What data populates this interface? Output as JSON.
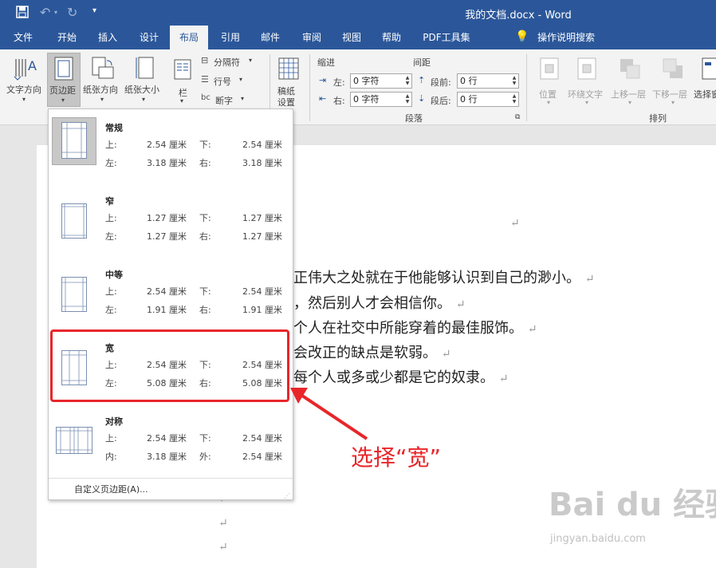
{
  "window": {
    "title": "我的文档.docx  -  Word"
  },
  "tabs": [
    {
      "label": "文件"
    },
    {
      "label": "开始"
    },
    {
      "label": "插入"
    },
    {
      "label": "设计"
    },
    {
      "label": "布局"
    },
    {
      "label": "引用"
    },
    {
      "label": "邮件"
    },
    {
      "label": "审阅"
    },
    {
      "label": "视图"
    },
    {
      "label": "帮助"
    },
    {
      "label": "PDF工具集"
    }
  ],
  "tell_me": "操作说明搜索",
  "ribbon": {
    "text_direction": "文字方向",
    "margins": "页边距",
    "orientation": "纸张方向",
    "size": "纸张大小",
    "columns": "栏",
    "breaks": "分隔符",
    "line_numbers": "行号",
    "hyphenation": "断字",
    "draft_line1": "稿纸",
    "draft_line2": "设置",
    "indent_label": "缩进",
    "spacing_label": "间距",
    "indent_left_label": "左:",
    "indent_left_value": "0 字符",
    "indent_right_label": "右:",
    "indent_right_value": "0 字符",
    "before_label": "段前:",
    "before_value": "0 行",
    "after_label": "段后:",
    "after_value": "0 行",
    "paragraph_group": "段落",
    "position": "位置",
    "wrap_text": "环绕文字",
    "bring_forward": "上移一层",
    "send_backward": "下移一层",
    "selection_pane": "选择窗",
    "arrange_group": "排列"
  },
  "margins_menu": {
    "options": [
      {
        "name": "常规",
        "r1l": "上:",
        "r1v": "2.54 厘米",
        "r1l2": "下:",
        "r1v2": "2.54 厘米",
        "r2l": "左:",
        "r2v": "3.18 厘米",
        "r2l2": "右:",
        "r2v2": "3.18 厘米"
      },
      {
        "name": "窄",
        "r1l": "上:",
        "r1v": "1.27 厘米",
        "r1l2": "下:",
        "r1v2": "1.27 厘米",
        "r2l": "左:",
        "r2v": "1.27 厘米",
        "r2l2": "右:",
        "r2v2": "1.27 厘米"
      },
      {
        "name": "中等",
        "r1l": "上:",
        "r1v": "2.54 厘米",
        "r1l2": "下:",
        "r1v2": "2.54 厘米",
        "r2l": "左:",
        "r2v": "1.91 厘米",
        "r2l2": "右:",
        "r2v2": "1.91 厘米"
      },
      {
        "name": "宽",
        "r1l": "上:",
        "r1v": "2.54 厘米",
        "r1l2": "下:",
        "r1v2": "2.54 厘米",
        "r2l": "左:",
        "r2v": "5.08 厘米",
        "r2l2": "右:",
        "r2v2": "5.08 厘米"
      },
      {
        "name": "对称",
        "r1l": "上:",
        "r1v": "2.54 厘米",
        "r1l2": "下:",
        "r1v2": "2.54 厘米",
        "r2l": "内:",
        "r2v": "3.18 厘米",
        "r2l2": "外:",
        "r2v2": "2.54 厘米"
      }
    ],
    "custom": "自定义页边距(A)..."
  },
  "document": {
    "lines": [
      "正伟大之处就在于他能够认识到自己的渺小。",
      "，然后别人才会相信你。",
      "个人在社交中所能穿着的最佳服饰。",
      "会改正的缺点是软弱。",
      "每个人或多或少都是它的奴隶。"
    ],
    "para_mark": "↵"
  },
  "annotation": {
    "text": "选择“宽”"
  },
  "watermark": {
    "main": "Bai du 经验",
    "sub": "jingyan.baidu.com"
  }
}
